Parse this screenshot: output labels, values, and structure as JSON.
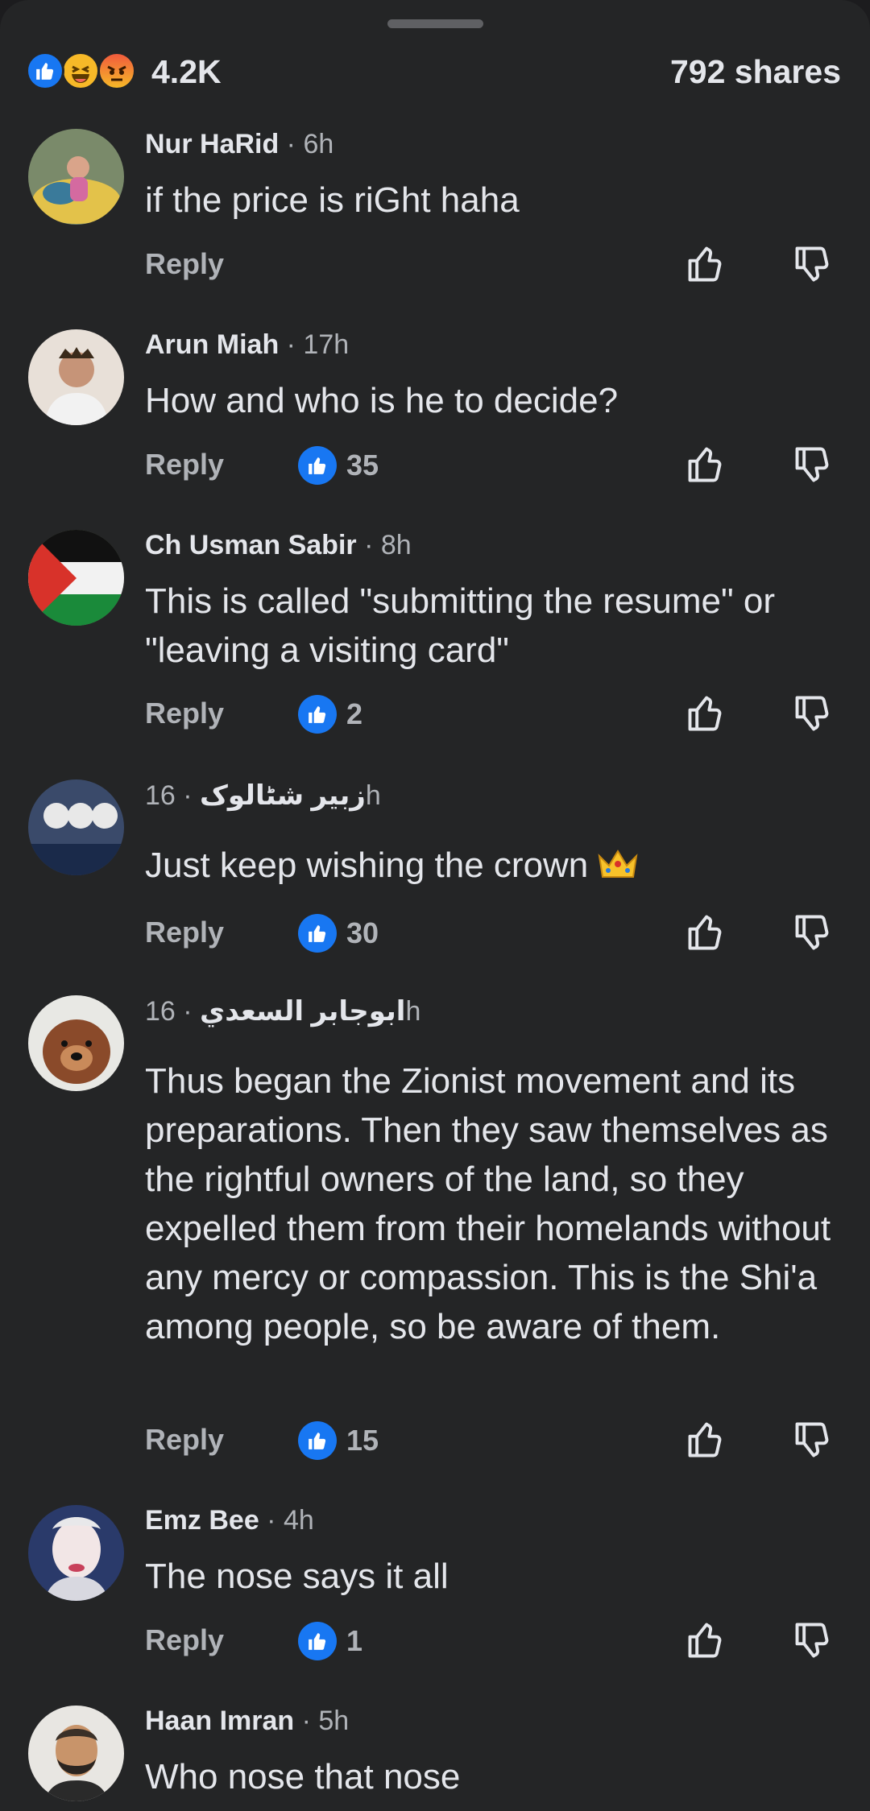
{
  "summary": {
    "reaction_count": "4.2K",
    "shares": "792 shares",
    "reaction_icons": [
      "like-icon",
      "haha-icon",
      "angry-icon"
    ]
  },
  "colors": {
    "background": "#242526",
    "like_blue": "#1877f2",
    "text_primary": "#e4e6eb",
    "text_secondary": "#b0b3b8"
  },
  "comments": [
    {
      "author": "Nur HaRid",
      "time": " · 6h",
      "text": "if the price is riGht haha",
      "reply": "Reply",
      "likes": ""
    },
    {
      "author": "Arun Miah",
      "time": " · 17h",
      "text": "How and who is he to decide?",
      "reply": "Reply",
      "likes": "35"
    },
    {
      "author": "Ch Usman Sabir",
      "time": " · 8h",
      "text": "This is called \"submitting the resume\" or \"leaving a visiting card\"",
      "reply": "Reply",
      "likes": "2"
    },
    {
      "author": "زبیر شٹالوک",
      "time": " · 16h",
      "text": "Just keep wishing the crown",
      "reply": "Reply",
      "likes": "30"
    },
    {
      "author": "ابوجابر السعدي",
      "time": " · 16h",
      "text": "Thus began the Zionist movement and its preparations. Then they saw themselves as the rightful owners of the land, so they expelled them from their homelands without any mercy or compassion. This is the Shi'a among people, so be aware of them.",
      "reply": "Reply",
      "likes": "15"
    },
    {
      "author": "Emz Bee",
      "time": " · 4h",
      "text": "The nose says it all",
      "reply": "Reply",
      "likes": "1"
    },
    {
      "author": "Haan Imran",
      "time": " · 5h",
      "text": "Who nose that nose",
      "reply": "",
      "likes": ""
    }
  ]
}
